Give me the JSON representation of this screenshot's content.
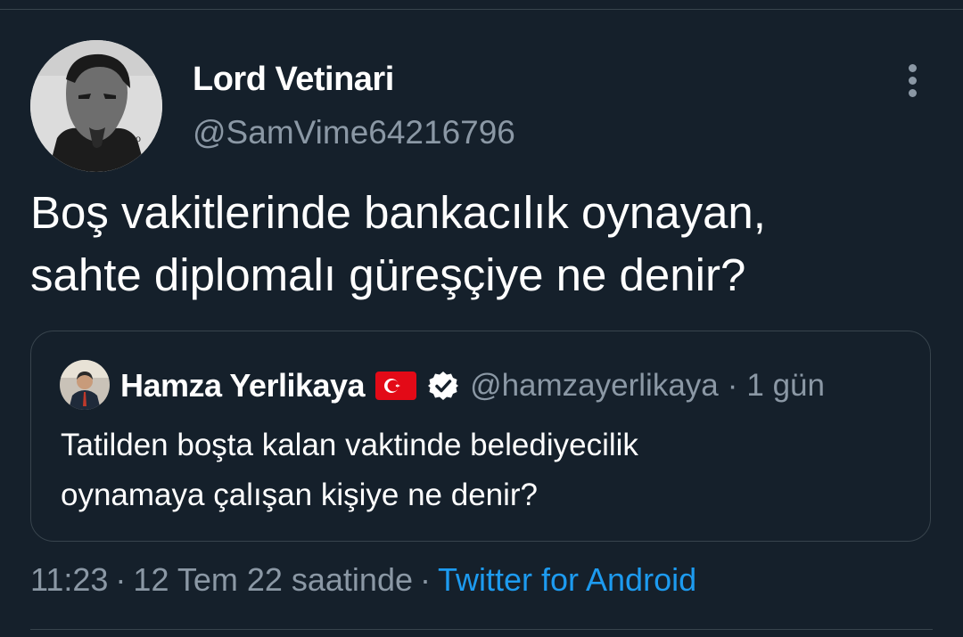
{
  "tweet": {
    "author_name": "Lord Vetinari",
    "author_handle": "@SamVime64216796",
    "text_lines": [
      "Boş vakitlerinde bankacılık oynayan,",
      "sahte diplomalı güreşçiye ne denir?"
    ],
    "avatar_icon": "portrait-avatar",
    "more_icon": "more-options-icon"
  },
  "quote": {
    "author_name": "Hamza Yerlikaya",
    "flag_icon": "turkey-flag-icon",
    "verified_icon": "verified-badge-icon",
    "author_handle": "@hamzayerlikaya",
    "separator": "·",
    "time": "1 gün",
    "text_lines": [
      "Tatilden boşta kalan vaktinde belediyecilik",
      "oynamaya çalışan kişiye ne denir?"
    ]
  },
  "meta": {
    "time": "11:23",
    "date": "12 Tem 22 saatinde",
    "separator": "·",
    "source": "Twitter for Android"
  },
  "colors": {
    "background": "#15202b",
    "primary_text": "#ffffff",
    "secondary_text": "#8b98a5",
    "link": "#1d9bf0",
    "border": "#38444d"
  }
}
